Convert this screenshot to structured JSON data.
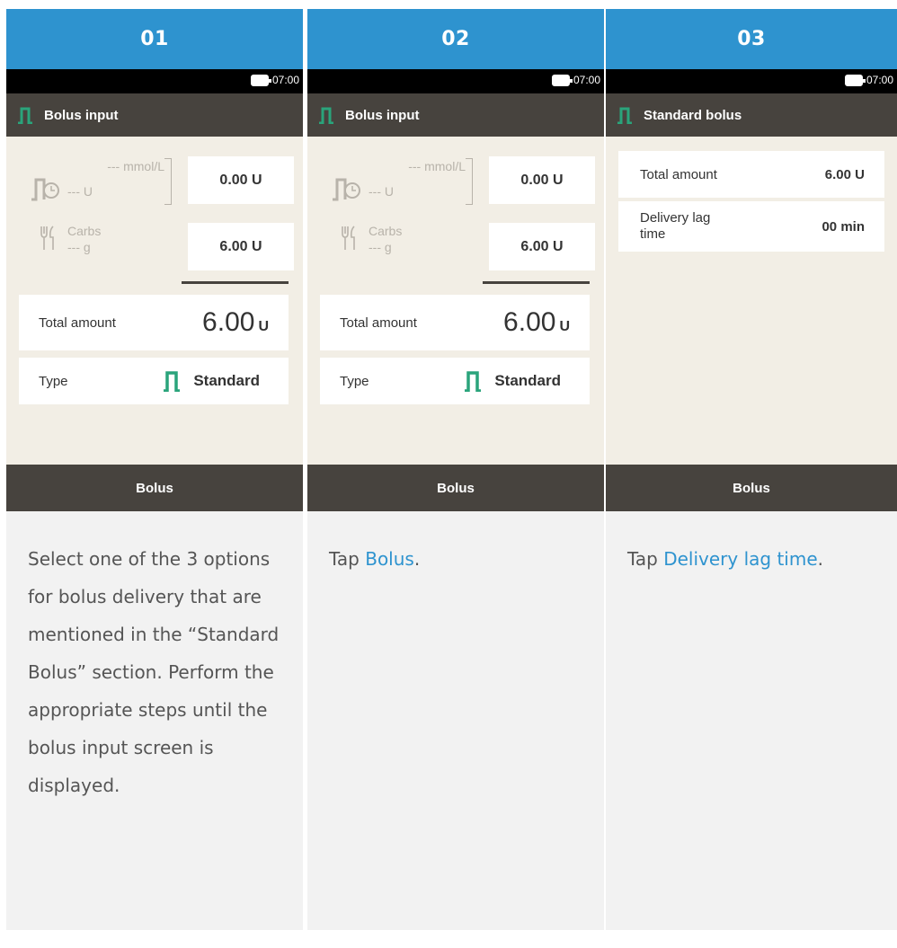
{
  "columns": [
    {
      "step": "01",
      "status_time": "07:00",
      "screen_title": "Bolus input",
      "bg_unit": "--- mmol/L",
      "correction_units": "--- U",
      "correction_value": "0.00 U",
      "carbs_label": "Carbs",
      "carbs_units": "--- g",
      "carbs_value": "6.00 U",
      "total_label": "Total amount",
      "total_value": "6.00",
      "total_unit": "U",
      "type_label": "Type",
      "type_value": "Standard",
      "softkey": "Bolus",
      "description": "Select one of the 3 options for bolus delivery that are mentioned in the “Standard Bolus” section. Perform the appropriate steps until the bolus input screen is displayed."
    },
    {
      "step": "02",
      "status_time": "07:00",
      "screen_title": "Bolus input",
      "bg_unit": "--- mmol/L",
      "correction_units": "--- U",
      "correction_value": "0.00 U",
      "carbs_label": "Carbs",
      "carbs_units": "--- g",
      "carbs_value": "6.00 U",
      "total_label": "Total amount",
      "total_value": "6.00",
      "total_unit": "U",
      "type_label": "Type",
      "type_value": "Standard",
      "softkey": "Bolus",
      "description_prefix": "Tap ",
      "description_link": "Bolus",
      "description_suffix": "."
    },
    {
      "step": "03",
      "status_time": "07:00",
      "screen_title": "Standard bolus",
      "total_label": "Total amount",
      "total_value": "6.00 U",
      "lag_label": "Delivery lag time",
      "lag_value": "00 min",
      "softkey": "Bolus",
      "description_prefix": "Tap ",
      "description_link": "Delivery lag time",
      "description_suffix": "."
    }
  ],
  "colors": {
    "header_blue": "#2e93cf",
    "bar_dark": "#47433e",
    "screen_bg": "#f2eee5",
    "icon_green": "#2aa47b",
    "link_blue": "#2e93cf"
  },
  "icons": {
    "bolus_type": "standard-bolus-icon",
    "battery": "battery-icon",
    "correction": "insulin-clock-icon",
    "carbs": "fork-knife-icon"
  }
}
